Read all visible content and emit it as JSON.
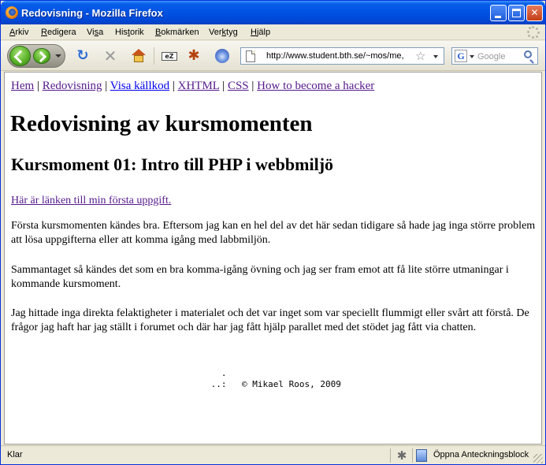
{
  "window": {
    "title": "Redovisning - Mozilla Firefox",
    "controls": {
      "minimize": "",
      "maximize": "",
      "close": "✕"
    }
  },
  "menubar": {
    "items": [
      {
        "underline": "A",
        "rest": "rkiv"
      },
      {
        "underline": "R",
        "rest": "edigera"
      },
      {
        "pre": "Vi",
        "underline": "s",
        "rest": "a"
      },
      {
        "pre": "His",
        "underline": "t",
        "rest": "orik"
      },
      {
        "underline": "B",
        "rest": "okmärken"
      },
      {
        "pre": "Ver",
        "underline": "k",
        "rest": "tyg"
      },
      {
        "underline": "H",
        "rest": "jälp"
      }
    ]
  },
  "toolbar": {
    "icons": [
      "back-icon",
      "forward-icon",
      "reload-icon",
      "stop-icon",
      "home-icon",
      "ez-icon",
      "firebug-icon",
      "swirl-icon"
    ],
    "url": "http://www.student.bth.se/~mos/me,",
    "search_placeholder": "Google",
    "search_engine_glyph": "G"
  },
  "page": {
    "nav_links": [
      "Hem",
      "Redovisning",
      "Visa källkod",
      "XHTML",
      "CSS",
      "How to become a hacker"
    ],
    "nav_separator": "|",
    "heading": "Redovisning av kursmomenten",
    "subheading": "Kursmoment 01: Intro till PHP i webbmiljö",
    "task_link": "Här är länken till min första uppgift.",
    "paragraphs": [
      "Första kursmomenten kändes bra. Eftersom jag kan en hel del av det här sedan tidigare så hade jag inga större problem att lösa uppgifterna eller att komma igång med labbmiljön.",
      "Sammantaget så kändes det som en bra komma-igång övning och jag ser fram emot att få lite större utmaningar i kommande kursmoment.",
      "Jag hittade inga direkta felaktigheter i materialet och det var inget som var speciellt flummigt eller svårt att förstå. De frågor jag haft har jag ställt i forumet och där har jag fått hjälp parallet med det stödet jag fått via chatten."
    ],
    "footer_art": "   .\n ..:",
    "footer_copyright": "© Mikael Roos, 2009"
  },
  "statusbar": {
    "text": "Klar",
    "notebook_label": "Öppna Anteckningsblock"
  },
  "colors": {
    "titlebar": "#0055E5",
    "visited_link": "#551A8B",
    "unvisited_link": "#0000EE",
    "chrome": "#ECE9D8"
  }
}
